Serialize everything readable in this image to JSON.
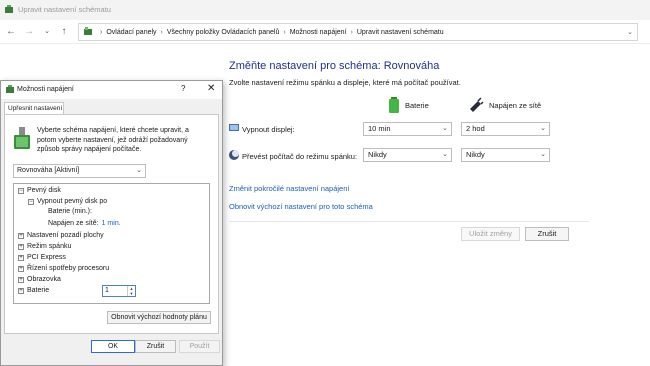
{
  "window": {
    "title": "Upravit nastavení schématu"
  },
  "breadcrumb": [
    "Ovládací panely",
    "Všechny položky Ovládacích panelů",
    "Možnosti napájení",
    "Upravit nastavení schématu"
  ],
  "main": {
    "heading": "Změňte nastavení pro schéma: Rovnováha",
    "subtext": "Zvolte nastavení režimu spánku a displeje, které má počítač používat.",
    "col_battery": "Baterie",
    "col_plugged": "Napájen ze sítě",
    "rows": [
      {
        "label": "Vypnout displej:",
        "battery": "10 min",
        "plugged": "2 hod"
      },
      {
        "label": "Převést počítač do režimu spánku:",
        "battery": "Nikdy",
        "plugged": "Nikdy"
      }
    ],
    "link_advanced": "Změnit pokročilé nastavení napájení",
    "link_restore": "Obnovit výchozí nastavení pro toto schéma",
    "save": "Uložit změny",
    "cancel": "Zrušit"
  },
  "dialog": {
    "title": "Možnosti napájení",
    "help": "?",
    "close": "✕",
    "tab": "Upřesnit nastavení",
    "description": "Vyberte schéma napájení, které chcete upravit, a potom vyberte nastavení, jež odráží požadovaný způsob správy napájení počítače.",
    "scheme": "Rovnováha [Aktivní]",
    "tree": {
      "disk": "Pevný disk",
      "disk_off": "Vypnout pevný disk po",
      "battery_label": "Baterie (min.):",
      "battery_value": "1",
      "plugged_label": "Napájen ze sítě:",
      "plugged_value": "1 min.",
      "desktop": "Nastavení pozadí plochy",
      "sleep": "Režim spánku",
      "pci": "PCI Express",
      "cpu": "Řízení spotřeby procesoru",
      "display": "Obrazovka",
      "battery": "Baterie"
    },
    "restore_btn": "Obnovit výchozí hodnoty plánu",
    "ok": "OK",
    "cancel": "Zrušit",
    "apply": "Použít"
  },
  "colors": {
    "heading": "#1e3287",
    "link": "#1a5ebc",
    "accent": "#2d6bd3"
  }
}
